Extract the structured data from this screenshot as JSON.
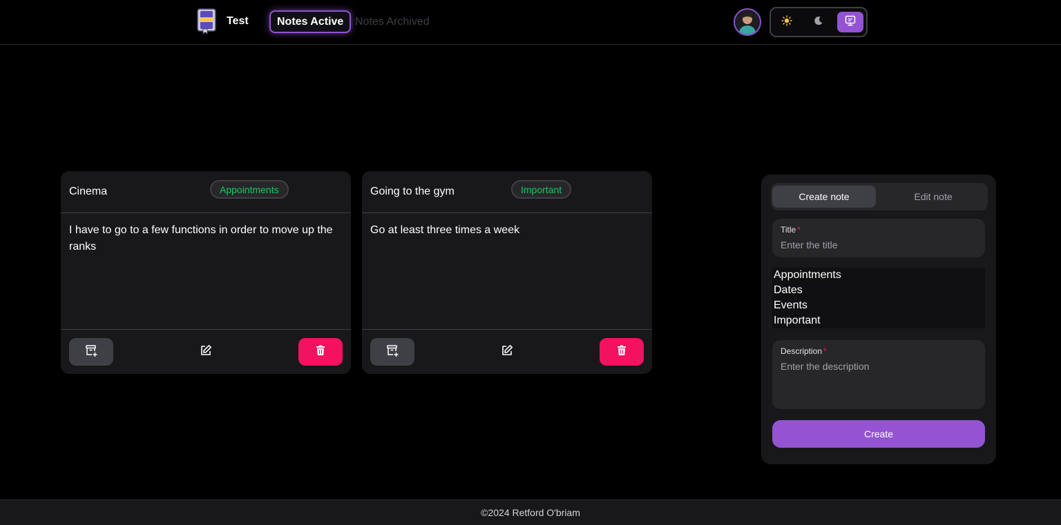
{
  "header": {
    "brand_name": "Test",
    "nav_active_label": "Notes Active",
    "nav_archived_label": "Notes Archived",
    "accent_color": "#9353d3",
    "icons": [
      "notebook-logo-icon",
      "user-avatar",
      "sun-icon",
      "moon-icon",
      "monitor-icon"
    ]
  },
  "notes": [
    {
      "title": "Cinema",
      "category": "Appointments",
      "description": "I have to go to a few functions in order to move up the ranks"
    },
    {
      "title": "Going to the gym",
      "category": "Important",
      "description": "Go at least three times a week"
    }
  ],
  "note_actions": {
    "icons": [
      "archive-icon",
      "edit-icon",
      "trash-icon"
    ],
    "delete_color": "#f31260",
    "chip_text_color": "#17c964"
  },
  "form": {
    "tabs": [
      "Create note",
      "Edit note"
    ],
    "title_label": "Title",
    "title_placeholder": "Enter the title",
    "title_value": "",
    "categories": [
      "Appointments",
      "Dates",
      "Events",
      "Important"
    ],
    "description_label": "Description",
    "description_placeholder": "Enter the description",
    "description_value": "",
    "submit_label": "Create"
  },
  "footer": {
    "text": "©2024 Retford O'briam"
  }
}
